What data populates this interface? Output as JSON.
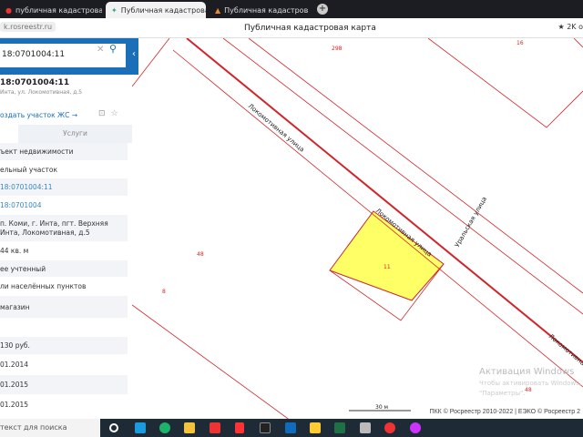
{
  "browser": {
    "tabs": [
      {
        "label": "публичная кадастровая к"
      },
      {
        "label": "Публичная кадастрова"
      },
      {
        "label": "Публичная кадастрова"
      }
    ],
    "new_tab": "+",
    "url": "k.rosreestr.ru",
    "page_title": "Публичная кадастровая карта",
    "rating": "★ 2K о"
  },
  "search": {
    "value": "18:0701004:11",
    "clear": "✕",
    "search_icon": "⚲",
    "collapse": "‹"
  },
  "object": {
    "number": "18:0701004:11",
    "address": "Инта, ул. Локомотивная, д.5",
    "create_link": "оздать участок ЖС →",
    "tabs": [
      "",
      "Услуги"
    ]
  },
  "rows": [
    "ъект недвижимости",
    "ельный участок",
    "18:0701004:11",
    "18:0701004",
    "п. Коми, г. Инта, пгт. Верхняя Инта, Локомотивная, д.5",
    "44 кв. м",
    "ее учтенный",
    "ли населённых пунктов",
    "магазин",
    "",
    "130 руб.",
    "01.2014",
    "01.2015",
    "01.2015"
  ],
  "map": {
    "labels": {
      "street1": "Локомотивная улица",
      "street2": "Локомотивная улица",
      "street3": "Уральская улица",
      "street4": "Локомотивная",
      "n298": "298",
      "n16": "16",
      "n48a": "48",
      "n8": "8",
      "n11": "11",
      "n48b": "48"
    },
    "scale": "30 м",
    "copyright": "ПКК © Росреестр 2010-2022 | ЕЭКО © Росреестр 2",
    "watermark": "Активация Windows",
    "watermark_sub": "Чтобы активировать Windows,",
    "watermark_sub2": "\"Параметры\".",
    "colors": {
      "boundary": "#d0262b",
      "parcel": "#ffff66"
    }
  },
  "taskbar": {
    "search": "текст для поиска"
  }
}
